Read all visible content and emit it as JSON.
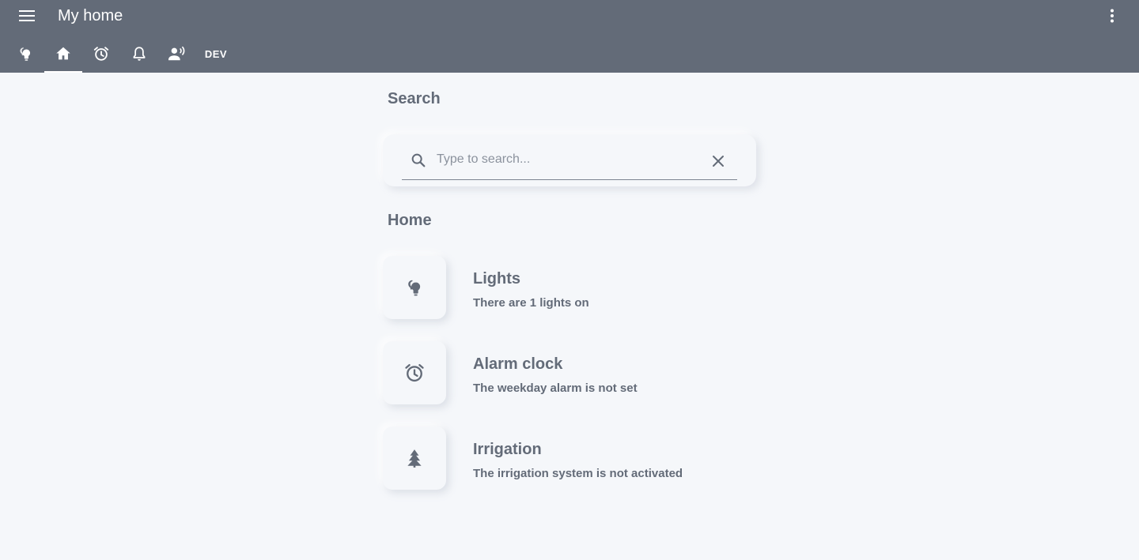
{
  "header": {
    "title": "My home",
    "menu_icon": "menu-icon",
    "overflow_icon": "more-vertical-icon",
    "background": "#636b78"
  },
  "tabs": [
    {
      "icon": "lightbulb-icon",
      "active": false
    },
    {
      "icon": "home-icon",
      "active": true
    },
    {
      "icon": "alarm-clock-icon",
      "active": false
    },
    {
      "icon": "bell-icon",
      "active": false
    },
    {
      "icon": "voice-person-icon",
      "active": false
    },
    {
      "label": "DEV",
      "active": false
    }
  ],
  "search": {
    "section_title": "Search",
    "placeholder": "Type to search...",
    "value": "",
    "search_icon": "search-icon",
    "clear_icon": "close-icon"
  },
  "home": {
    "section_title": "Home",
    "tiles": [
      {
        "icon": "lightbulb-icon",
        "title": "Lights",
        "subtitle": "There are 1 lights on"
      },
      {
        "icon": "alarm-clock-icon",
        "title": "Alarm clock",
        "subtitle": "The weekday alarm is not set"
      },
      {
        "icon": "tree-icon",
        "title": "Irrigation",
        "subtitle": "The irrigation system is not activated"
      }
    ]
  },
  "colors": {
    "page_background": "#f5f7fa",
    "text": "#636b78"
  }
}
